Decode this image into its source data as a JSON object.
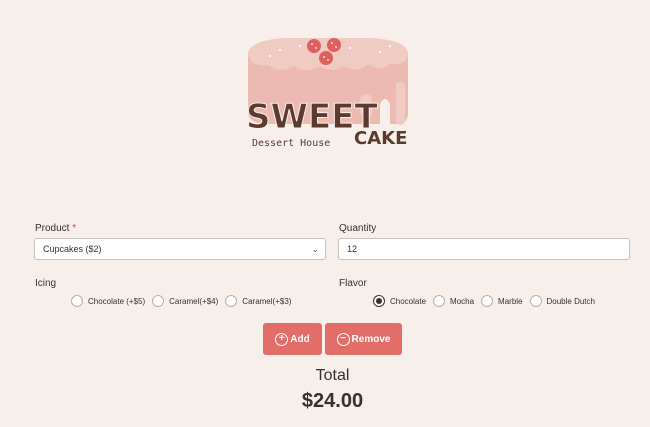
{
  "brand": {
    "name_top": "SWEET",
    "name_side": "CAKE",
    "tagline": "Dessert House",
    "colors": {
      "accent": "#e26d69",
      "cake": "#eab7ad",
      "chocolate": "#5a3b2e",
      "strawberry": "#e06060"
    }
  },
  "form": {
    "product": {
      "label": "Product",
      "required_mark": "*",
      "value": "Cupcakes ($2)"
    },
    "quantity": {
      "label": "Quantity",
      "value": "12"
    },
    "icing": {
      "label": "Icing",
      "options": [
        "Chocolate (+$5)",
        "Caramel(+$4)",
        "Caramel(+$3)"
      ]
    },
    "flavor": {
      "label": "Flavor",
      "options": [
        "Chocolate",
        "Mocha",
        "Marble",
        "Double Dutch"
      ],
      "selected": "Chocolate"
    }
  },
  "buttons": {
    "add": "Add",
    "remove": "Remove"
  },
  "total": {
    "label": "Total",
    "value": "$24.00"
  }
}
